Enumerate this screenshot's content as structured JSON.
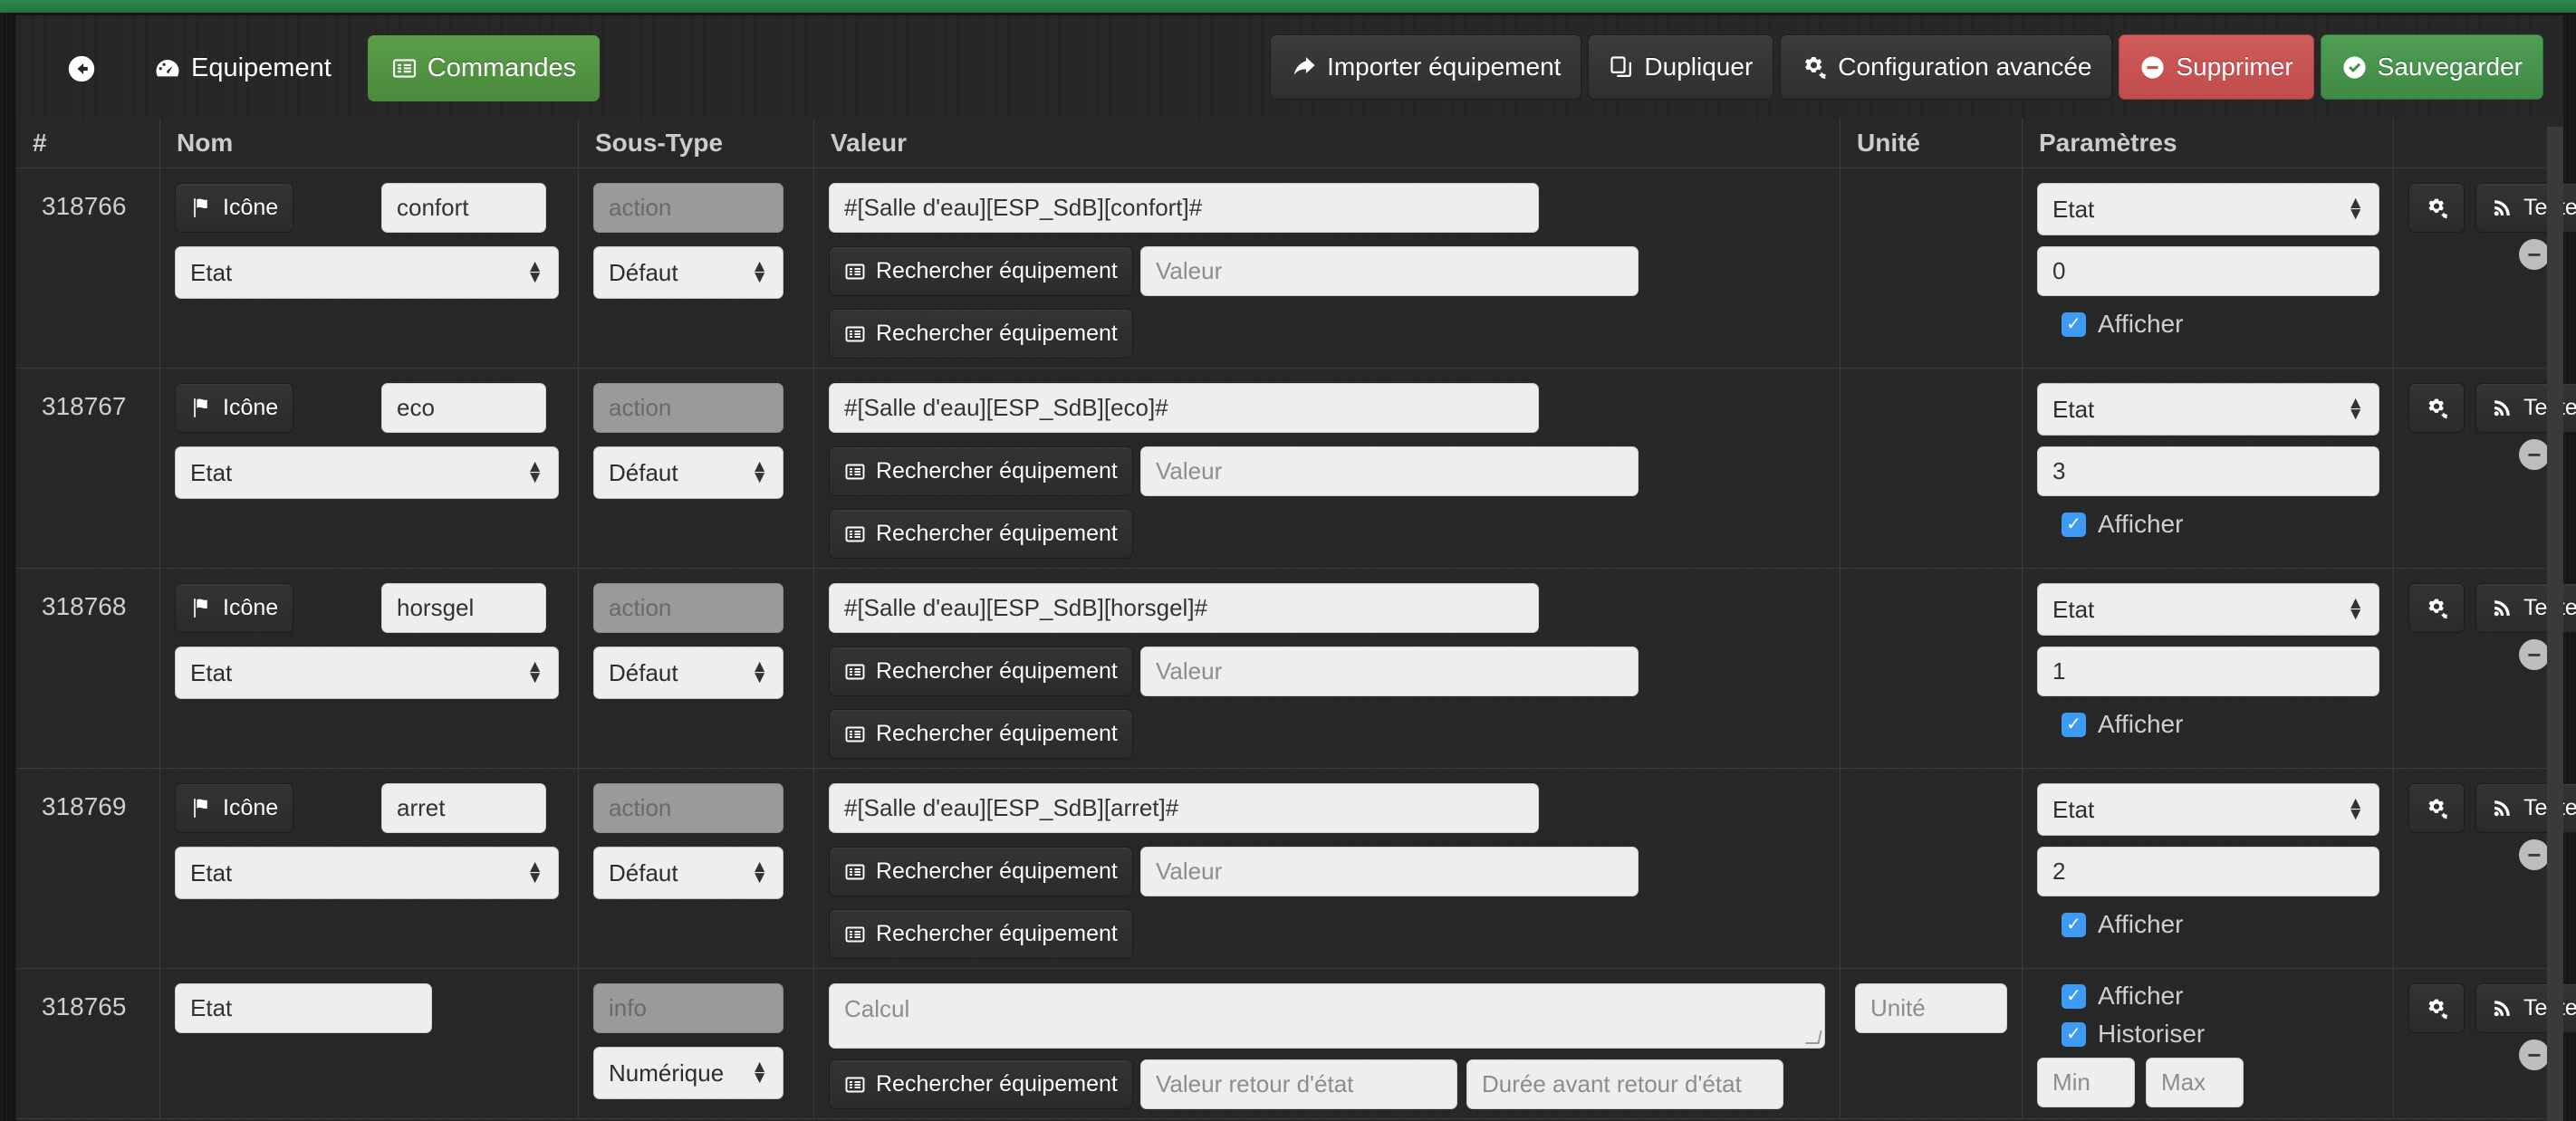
{
  "nav": {
    "back_icon": "arrow-circle-left-icon",
    "tabs": [
      {
        "label": "Equipement",
        "icon": "dashboard-icon",
        "active": false
      },
      {
        "label": "Commandes",
        "icon": "list-alt-icon",
        "active": true
      }
    ],
    "actions": [
      {
        "label": "Importer équipement",
        "icon": "share-icon",
        "style": "default"
      },
      {
        "label": "Dupliquer",
        "icon": "copy-icon",
        "style": "default"
      },
      {
        "label": "Configuration avancée",
        "icon": "cogs-icon",
        "style": "default"
      },
      {
        "label": "Supprimer",
        "icon": "minus-circle-icon",
        "style": "danger"
      },
      {
        "label": "Sauvegarder",
        "icon": "check-circle-icon",
        "style": "success"
      }
    ]
  },
  "table": {
    "columns": [
      "#",
      "Nom",
      "Sous-Type",
      "Valeur",
      "Unité",
      "Paramètres",
      ""
    ],
    "common": {
      "icon_button": "Icône",
      "search_equipment": "Rechercher équipement",
      "test_button": "Tester",
      "afficher_label": "Afficher",
      "historiser_label": "Historiser",
      "value_placeholder": "Valeur",
      "unit_placeholder": "Unité",
      "calcul_placeholder": "Calcul",
      "state_return_value_placeholder": "Valeur retour d'état",
      "state_return_delay_placeholder": "Durée avant retour d'état",
      "min_placeholder": "Min",
      "max_placeholder": "Max",
      "gear_icon": "cogs-icon",
      "flag_icon": "flag-icon",
      "rss_icon": "rss-icon",
      "list_icon": "list-alt-icon",
      "remove_icon": "minus-circle-icon"
    },
    "rows": [
      {
        "id": "318766",
        "kind": "action",
        "icon_label": "Icône",
        "name": "confort",
        "type_select": "Etat",
        "subtype_disabled": "action",
        "subtype_select": "Défaut",
        "value": "#[Salle d'eau][ESP_SdB][confort]#",
        "value_placeholder": "Valeur",
        "unit": "",
        "param_select": "Etat",
        "param_value": "0",
        "afficher_checked": true
      },
      {
        "id": "318767",
        "kind": "action",
        "icon_label": "Icône",
        "name": "eco",
        "type_select": "Etat",
        "subtype_disabled": "action",
        "subtype_select": "Défaut",
        "value": "#[Salle d'eau][ESP_SdB][eco]#",
        "value_placeholder": "Valeur",
        "unit": "",
        "param_select": "Etat",
        "param_value": "3",
        "afficher_checked": true
      },
      {
        "id": "318768",
        "kind": "action",
        "icon_label": "Icône",
        "name": "horsgel",
        "type_select": "Etat",
        "subtype_disabled": "action",
        "subtype_select": "Défaut",
        "value": "#[Salle d'eau][ESP_SdB][horsgel]#",
        "value_placeholder": "Valeur",
        "unit": "",
        "param_select": "Etat",
        "param_value": "1",
        "afficher_checked": true
      },
      {
        "id": "318769",
        "kind": "action",
        "icon_label": "Icône",
        "name": "arret",
        "type_select": "Etat",
        "subtype_disabled": "action",
        "subtype_select": "Défaut",
        "value": "#[Salle d'eau][ESP_SdB][arret]#",
        "value_placeholder": "Valeur",
        "unit": "",
        "param_select": "Etat",
        "param_value": "2",
        "afficher_checked": true
      },
      {
        "id": "318765",
        "kind": "info",
        "name": "Etat",
        "subtype_disabled": "info",
        "subtype_select": "Numérique",
        "calcul_placeholder": "Calcul",
        "unit_placeholder": "Unité",
        "state_return_value_placeholder": "Valeur retour d'état",
        "state_return_delay_placeholder": "Durée avant retour d'état",
        "min_placeholder": "Min",
        "max_placeholder": "Max",
        "afficher_checked": true,
        "historiser_checked": true
      }
    ]
  },
  "colors": {
    "accent_green": "#2d8a4e",
    "tab_active": "#5a9e49",
    "danger": "#cf5b5b",
    "success": "#4e9e54",
    "checkbox_blue": "#3d9bf5"
  }
}
